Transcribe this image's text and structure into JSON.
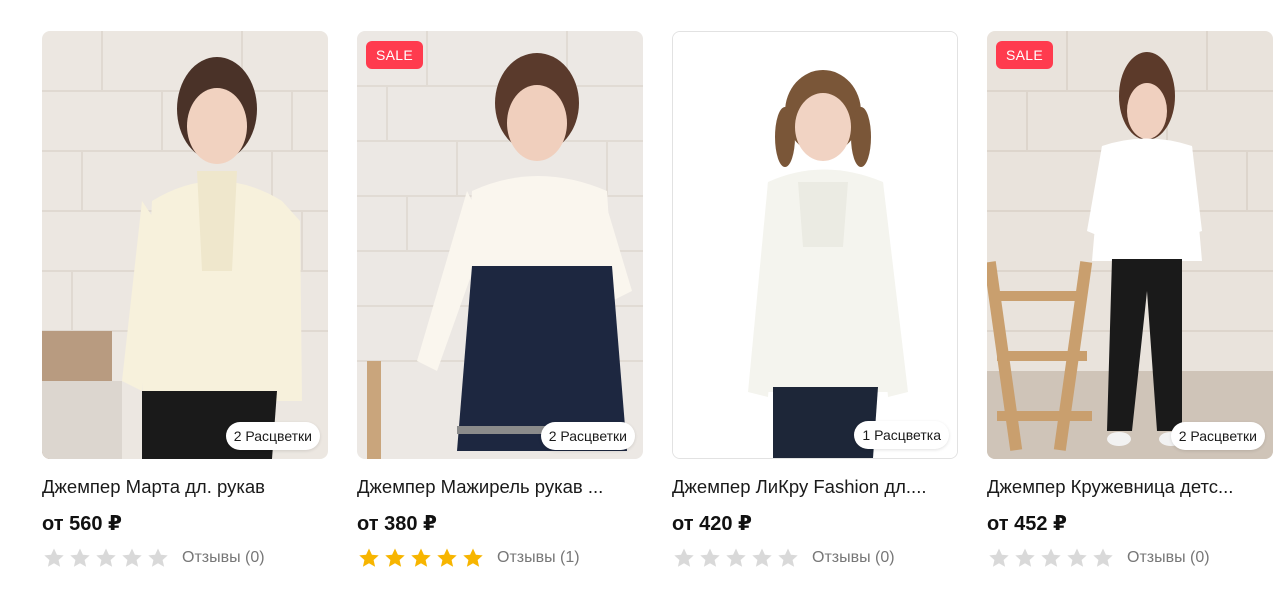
{
  "products": [
    {
      "title": "Джемпер Марта дл. рукав",
      "price": "от 560 ₽",
      "sale": false,
      "sale_label": "",
      "colors_label": "2 Расцветки",
      "rating": 0,
      "reviews_label": "Отзывы (0)"
    },
    {
      "title": "Джемпер Мажирель рукав ...",
      "price": "от 380 ₽",
      "sale": true,
      "sale_label": "SALE",
      "colors_label": "2 Расцветки",
      "rating": 5,
      "reviews_label": "Отзывы (1)"
    },
    {
      "title": "Джемпер ЛиКру Fashion дл....",
      "price": "от 420 ₽",
      "sale": false,
      "sale_label": "",
      "colors_label": "1 Расцветка",
      "rating": 0,
      "reviews_label": "Отзывы (0)"
    },
    {
      "title": "Джемпер Кружевница детс...",
      "price": "от 452 ₽",
      "sale": true,
      "sale_label": "SALE",
      "colors_label": "2 Расцветки",
      "rating": 0,
      "reviews_label": "Отзывы (0)"
    }
  ],
  "colors": {
    "sale_badge": "#ff3b4e",
    "star_filled": "#f7b500",
    "star_empty": "#d9d9d9",
    "reviews_text": "#777777"
  }
}
